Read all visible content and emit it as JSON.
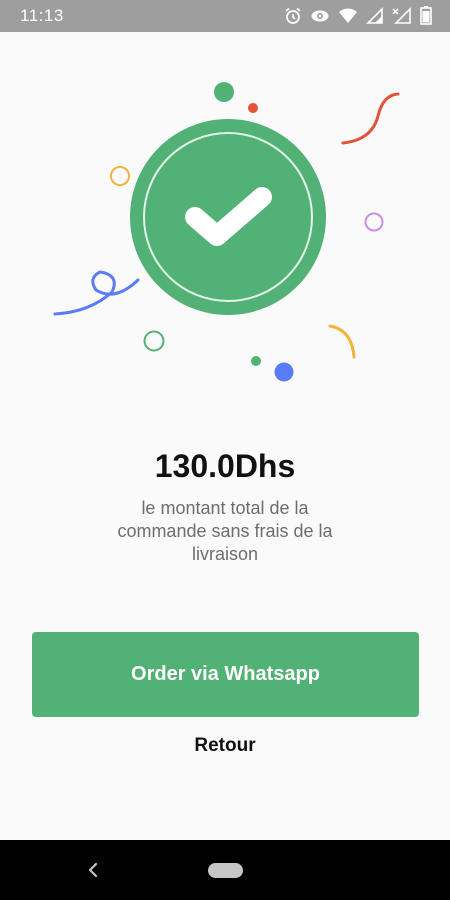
{
  "status_bar": {
    "time": "11:13",
    "icons": [
      "alarm-icon",
      "eye-icon",
      "wifi-icon",
      "signal-icon",
      "signal-no-data-icon",
      "battery-icon"
    ]
  },
  "confirmation": {
    "amount": "130.0Dhs",
    "subtitle": "le montant total de la commande sans frais de la livraison"
  },
  "actions": {
    "order_label": "Order via Whatsapp",
    "back_label": "Retour"
  },
  "colors": {
    "accent": "#52b275",
    "confetti_red": "#e2543a",
    "confetti_blue": "#5b7cf7",
    "confetti_orange": "#f2b43c",
    "confetti_purple": "#c98ee0"
  },
  "nav_bar": {
    "icons": [
      "back-icon",
      "home-pill"
    ]
  }
}
